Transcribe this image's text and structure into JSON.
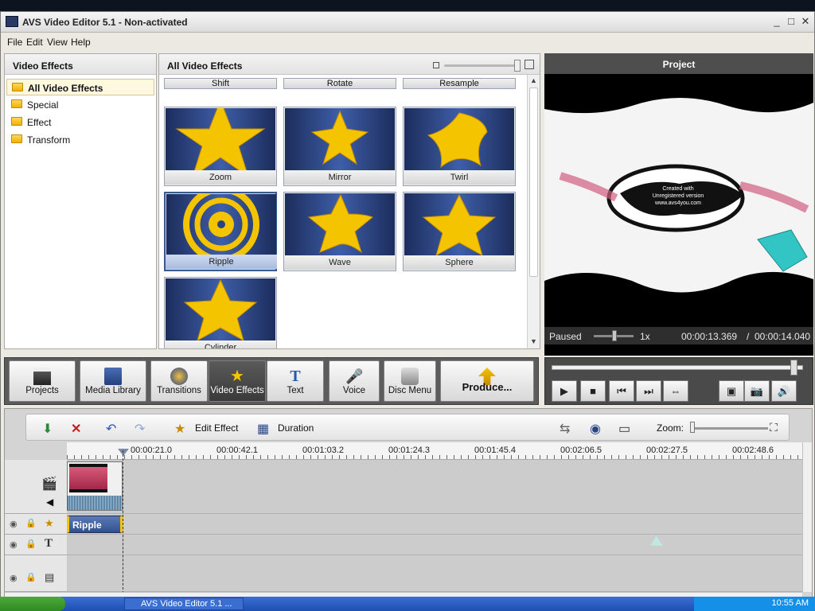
{
  "window": {
    "title": "AVS Video Editor 5.1 - Non-activated",
    "controls": {
      "minimize": "_",
      "maximize": "□",
      "close": "✕"
    }
  },
  "menu": {
    "file": "File",
    "edit": "Edit",
    "view": "View",
    "help": "Help"
  },
  "left_panel": {
    "title": "Video Effects",
    "items": [
      {
        "label": "All Video Effects",
        "selected": true
      },
      {
        "label": "Special"
      },
      {
        "label": "Effect"
      },
      {
        "label": "Transform"
      }
    ]
  },
  "center_panel": {
    "title": "All Video Effects",
    "top_row": [
      "Shift",
      "Rotate",
      "Resample"
    ],
    "effects": [
      "Zoom",
      "Mirror",
      "Twirl",
      "Ripple",
      "Wave",
      "Sphere",
      "Cylinder"
    ],
    "selected": "Ripple"
  },
  "right_panel": {
    "title": "Project",
    "status": "Paused",
    "speed": "1x",
    "current_time": "00:00:13.369",
    "separator": "/",
    "total_time": "00:00:14.040",
    "overlay_text": "Created with Unregistered version www.avs4you.com"
  },
  "toolbar": {
    "projects": "Projects",
    "media_library": "Media Library",
    "transitions": "Transitions",
    "video_effects": "Video Effects",
    "text": "Text",
    "voice": "Voice",
    "disc_menu": "Disc Menu",
    "produce": "Produce..."
  },
  "timeline": {
    "edit_effect": "Edit Effect",
    "duration": "Duration",
    "zoom_label": "Zoom:",
    "ruler": [
      "00:00:21.0",
      "00:00:42.1",
      "00:01:03.2",
      "00:01:24.3",
      "00:01:45.4",
      "00:02:06.5",
      "00:02:27.5",
      "00:02:48.6"
    ],
    "effect_clip": "Ripple"
  },
  "taskbar": {
    "item": "AVS Video Editor 5.1 ...",
    "clock": "10:55 AM"
  },
  "colors": {
    "accent": "#3b5a8f",
    "star": "#f5c400",
    "effect_bg": "#2a4482",
    "clip_pink": "#d95a7a"
  }
}
